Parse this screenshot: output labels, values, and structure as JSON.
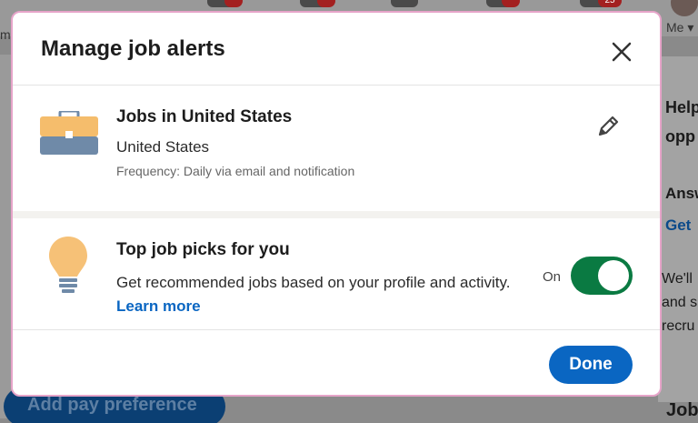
{
  "background": {
    "nav_badges": [
      "",
      "",
      "",
      "",
      "25"
    ],
    "me_label": "Me",
    "left_fragment": "mi",
    "right_card_fragments": [
      "Help",
      "opp",
      "Answ",
      "Get",
      "We'll",
      "and s",
      "recru"
    ],
    "pay_button_label": "Add pay preference",
    "job_fragment": "Job"
  },
  "modal": {
    "title": "Manage job alerts",
    "close_icon": "close-icon",
    "alert": {
      "icon": "briefcase-icon",
      "title": "Jobs in United States",
      "location": "United States",
      "frequency": "Frequency: Daily via email and notification",
      "edit_icon": "pencil-icon"
    },
    "picks": {
      "icon": "lightbulb-icon",
      "title": "Top job picks for you",
      "description": "Get recommended jobs based on your profile and activity.",
      "learn_more": "Learn more",
      "toggle_label": "On",
      "toggle_on": true
    },
    "done_label": "Done"
  },
  "colors": {
    "accent": "#0a66c2",
    "toggle_on": "#0a7a42",
    "briefcase_top": "#f5bd6c",
    "briefcase_bottom": "#6f8aa8",
    "bulb": "#f6c177"
  }
}
